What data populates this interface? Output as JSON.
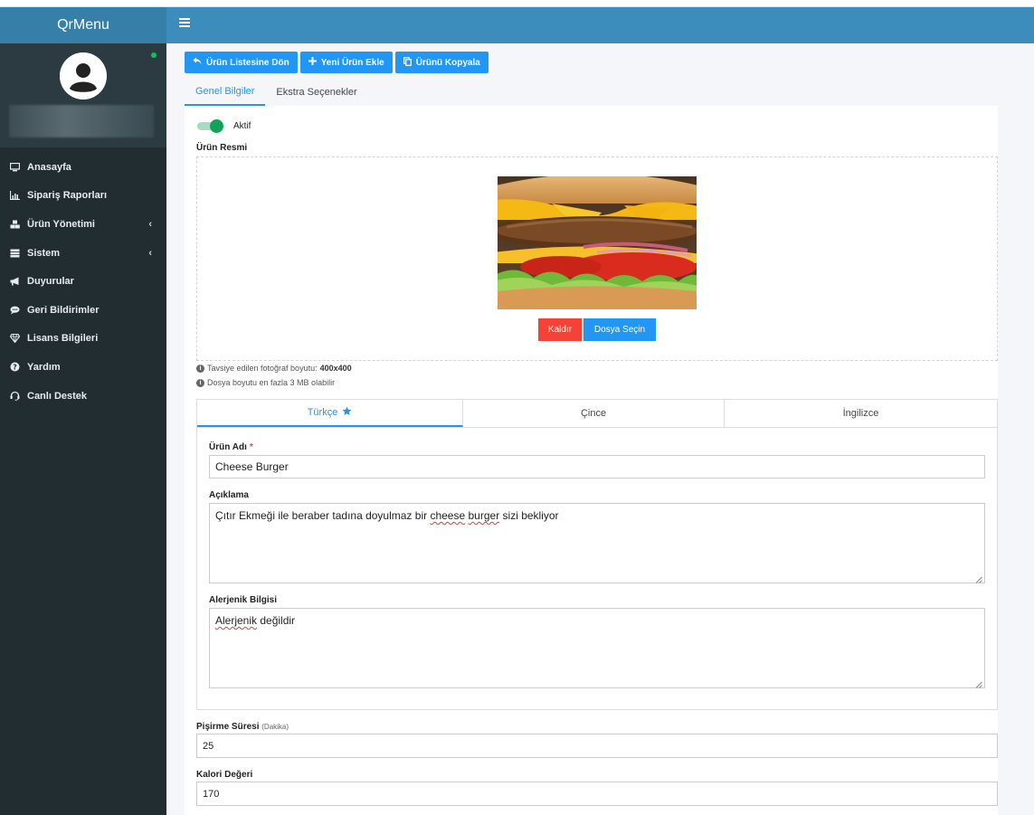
{
  "app": {
    "brand": "QrMenu"
  },
  "sidebar": {
    "items": [
      {
        "label": "Anasayfa",
        "icon": "monitor-icon",
        "has_caret": false
      },
      {
        "label": "Sipariş Raporları",
        "icon": "chart-icon",
        "has_caret": false
      },
      {
        "label": "Ürün Yönetimi",
        "icon": "cubes-icon",
        "has_caret": true
      },
      {
        "label": "Sistem",
        "icon": "server-icon",
        "has_caret": true
      },
      {
        "label": "Duyurular",
        "icon": "megaphone-icon",
        "has_caret": false
      },
      {
        "label": "Geri Bildirimler",
        "icon": "comments-icon",
        "has_caret": false
      },
      {
        "label": "Lisans Bilgileri",
        "icon": "diamond-icon",
        "has_caret": false
      },
      {
        "label": "Yardım",
        "icon": "question-icon",
        "has_caret": false
      },
      {
        "label": "Canlı Destek",
        "icon": "headset-icon",
        "has_caret": false
      }
    ]
  },
  "toolbar": {
    "back_label": "Ürün Listesine Dön",
    "new_label": "Yeni Ürün Ekle",
    "copy_label": "Ürünü Kopyala"
  },
  "tabs": [
    {
      "label": "Genel Bilgiler",
      "active": true
    },
    {
      "label": "Ekstra Seçenekler",
      "active": false
    }
  ],
  "form": {
    "active_label": "Aktif",
    "active_value": true,
    "image_label": "Ürün Resmi",
    "remove_label": "Kaldır",
    "select_file_label": "Dosya Seçin",
    "hint_size_text": "Tavsiye edilen fotoğraf boyutu:",
    "hint_size_value": "400x400",
    "hint_filesize": "Dosya boyutu en fazla 3 MB olabilir",
    "languages": [
      {
        "label": "Türkçe",
        "active": true
      },
      {
        "label": "Çince",
        "active": false
      },
      {
        "label": "İngilizce",
        "active": false
      }
    ],
    "name_label": "Ürün Adı",
    "name_required": "*",
    "name_value": "Cheese Burger",
    "desc_label": "Açıklama",
    "desc_part1": "Çıtır Ekmeği ile beraber tadına doyulmaz bir ",
    "desc_word1": "cheese",
    "desc_space": " ",
    "desc_word2": "burger",
    "desc_part2": " sizi bekliyor",
    "allergen_label": "Alerjenik Bilgisi",
    "allergen_word": "Alerjenik",
    "allergen_rest": " değildir",
    "cook_label": "Pişirme Süresi",
    "cook_unit": "(Dakika)",
    "cook_value": "25",
    "calorie_label": "Kalori Değeri",
    "calorie_value": "170"
  },
  "colors": {
    "brand_bar": "#367fa9",
    "header": "#3c8dbc",
    "sidebar": "#222d32",
    "primary": "#2196f3",
    "danger": "#f44336",
    "toggle_on": "#12a35a"
  }
}
